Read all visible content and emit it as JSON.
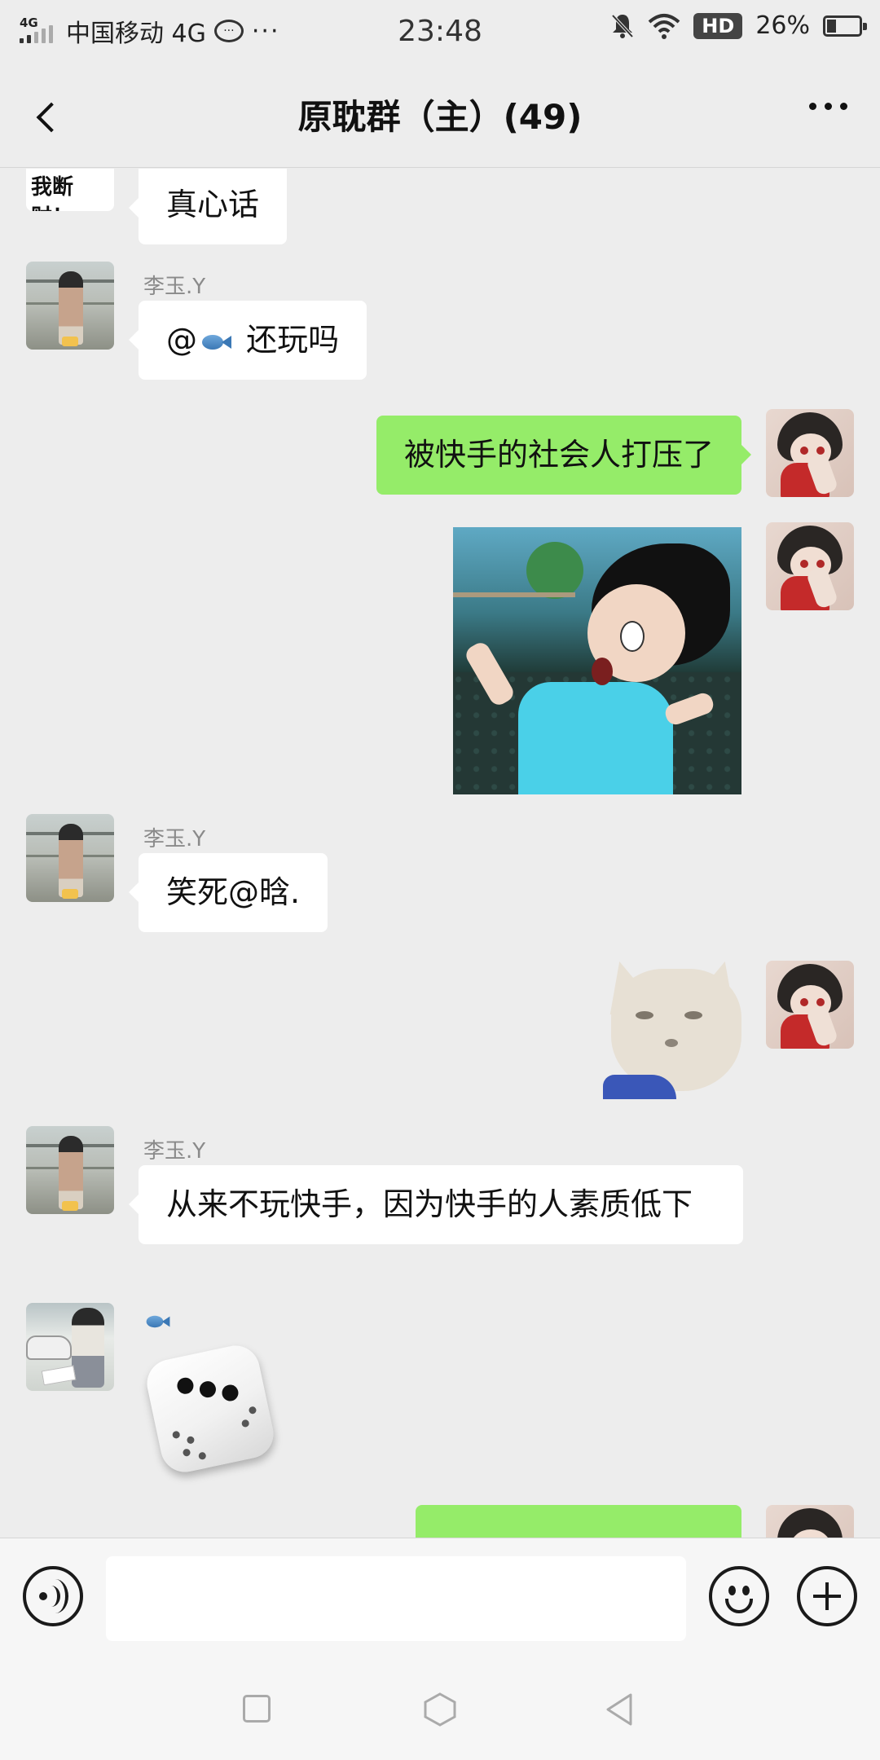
{
  "status_bar": {
    "network_tag": "4G",
    "carrier": "中国移动 4G",
    "more": "···",
    "time": "23:48",
    "hd_badge": "HD",
    "battery": "26%",
    "battery_level": 0.26
  },
  "header": {
    "title": "原耽群（主）(49)"
  },
  "messages": {
    "m0": {
      "partial_text": "我断财！",
      "text": "真心话"
    },
    "m1": {
      "sender": "李玉.Y",
      "text_prefix": "@",
      "icon": "fish-emoji",
      "text_suffix": "还玩吗"
    },
    "m2": {
      "text": "被快手的社会人打压了"
    },
    "m3": {
      "type": "sticker",
      "description_icon": "cartoon-boy-sticker"
    },
    "m4": {
      "sender": "李玉.Y",
      "text": "笑死@晗."
    },
    "m5": {
      "type": "sticker",
      "description_icon": "cat-sticker"
    },
    "m6": {
      "sender": "李玉.Y",
      "text": "从来不玩快手，因为快手的人素质低下"
    },
    "m7": {
      "sender_icon": "fish-emoji",
      "type": "dice",
      "dice_value": 3
    },
    "m8": {
      "type": "partial"
    }
  },
  "input_bar": {
    "placeholder": ""
  },
  "colors": {
    "background": "#ededed",
    "bubble_self": "#95ec69",
    "bubble_other": "#ffffff",
    "sender_name": "#8a8a8a"
  }
}
